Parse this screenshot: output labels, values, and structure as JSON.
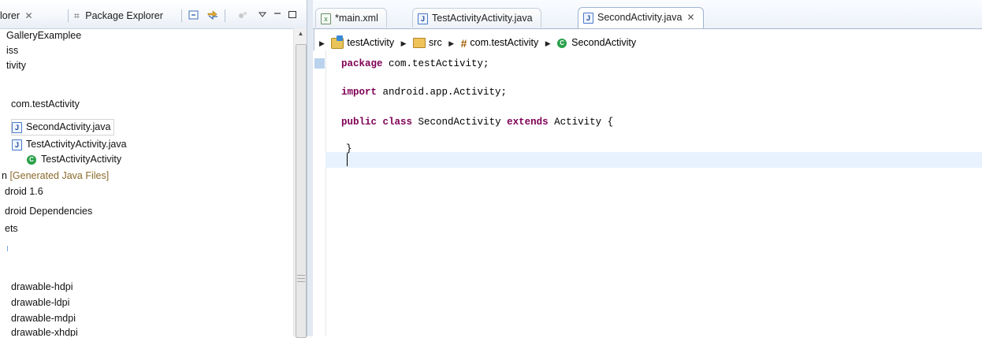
{
  "left_tabs": {
    "outline_partial": "lorer",
    "package_explorer": "Package Explorer",
    "close_glyph": "✕"
  },
  "tree": [
    {
      "label": "GalleryExamplee",
      "kind": "text"
    },
    {
      "label": "iss",
      "kind": "text"
    },
    {
      "label": "tivity",
      "kind": "text"
    },
    {
      "label": "",
      "kind": "blank"
    },
    {
      "label": "com.testActivity",
      "kind": "text"
    },
    {
      "label": "SecondActivity.java",
      "kind": "java",
      "selected": true
    },
    {
      "label": "TestActivityActivity.java",
      "kind": "java"
    },
    {
      "label": "TestActivityActivity",
      "kind": "class"
    },
    {
      "label": "[Generated Java Files]",
      "kind": "gen",
      "prefix": "n"
    },
    {
      "label": "droid 1.6",
      "kind": "text"
    },
    {
      "label": "droid Dependencies",
      "kind": "text"
    },
    {
      "label": "ets",
      "kind": "text"
    },
    {
      "label": "",
      "kind": "blank"
    },
    {
      "label": "",
      "kind": "blank"
    },
    {
      "label": "drawable-hdpi",
      "kind": "text"
    },
    {
      "label": "drawable-ldpi",
      "kind": "text"
    },
    {
      "label": "drawable-mdpi",
      "kind": "text"
    },
    {
      "label": "drawable-xhdpi",
      "kind": "text"
    }
  ],
  "editor_tabs": [
    {
      "label": "*main.xml",
      "icon": "xml-file-icon"
    },
    {
      "label": "TestActivityActivity.java",
      "icon": "java-file-icon"
    },
    {
      "label": "SecondActivity.java",
      "icon": "java-file-icon",
      "active": true,
      "close": "✕"
    }
  ],
  "breadcrumb": {
    "project": "testActivity",
    "folder": "src",
    "package": "com.testActivity",
    "class": "SecondActivity"
  },
  "code": {
    "line1_kw": "package",
    "line1_rest": " com.testActivity;",
    "line2_kw": "import",
    "line2_rest": " android.app.Activity;",
    "line3_kw1": "public",
    "line3_kw2": "class",
    "line3_mid": " SecondActivity ",
    "line3_kw3": "extends",
    "line3_rest": " Activity {",
    "line4": "}"
  },
  "colors": {
    "keyword": "#7f0055",
    "current_line": "#e8f2fe",
    "class_icon": "#2aa14a"
  }
}
